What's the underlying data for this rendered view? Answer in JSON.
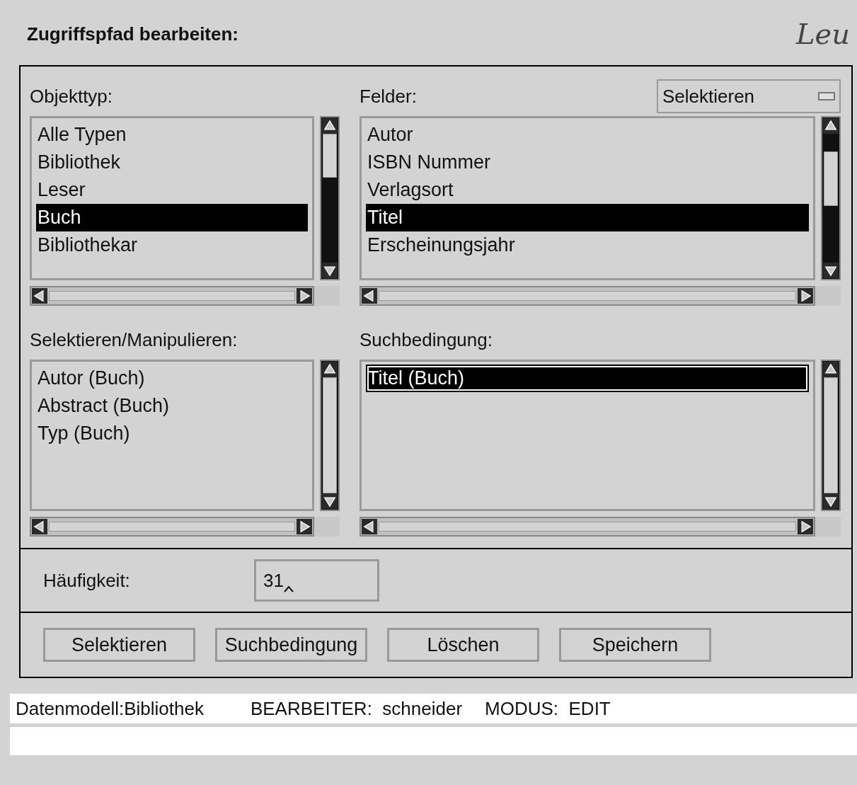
{
  "title": "Zugriffspfad bearbeiten:",
  "logo": "Leu",
  "panels": [
    {
      "label": "Objekttyp:",
      "items": [
        {
          "text": "Alle Typen",
          "selected": false
        },
        {
          "text": "Bibliothek",
          "selected": false
        },
        {
          "text": "Leser",
          "selected": false
        },
        {
          "text": "Buch",
          "selected": true
        },
        {
          "text": "Bibliothekar",
          "selected": false
        }
      ]
    },
    {
      "label": "Felder:",
      "items": [
        {
          "text": "Autor",
          "selected": false
        },
        {
          "text": "ISBN Nummer",
          "selected": false
        },
        {
          "text": "Verlagsort",
          "selected": false
        },
        {
          "text": "Titel",
          "selected": true
        },
        {
          "text": "Erscheinungsjahr",
          "selected": false
        }
      ]
    },
    {
      "label": "Selektieren/Manipulieren:",
      "items": [
        {
          "text": "Autor (Buch)",
          "selected": false
        },
        {
          "text": "Abstract (Buch)",
          "selected": false
        },
        {
          "text": "Typ (Buch)",
          "selected": false
        }
      ]
    },
    {
      "label": "Suchbedingung:",
      "items": [
        {
          "text": "Titel (Buch)",
          "selected": true,
          "focused": true
        }
      ]
    }
  ],
  "mode_dropdown": {
    "value": "Selektieren"
  },
  "frequency": {
    "label": "Häufigkeit:",
    "value": "31"
  },
  "buttons": [
    "Selektieren",
    "Suchbedingung",
    "Löschen",
    "Speichern"
  ],
  "status_bar": [
    "Datenmodell:Bibliothek",
    "BEARBEITER:  schneider",
    "MODUS:  EDIT"
  ]
}
